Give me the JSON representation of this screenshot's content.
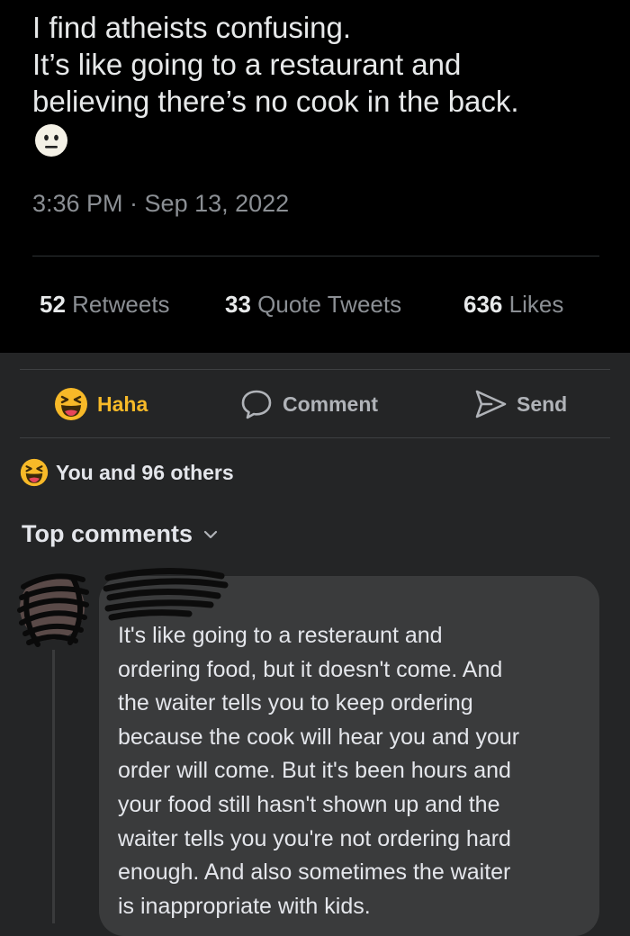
{
  "tweet": {
    "lines": [
      "I find atheists confusing.",
      "It’s like going to a restaurant and",
      "believing there’s no cook in the back."
    ],
    "emoji": "neutral-face-icon",
    "timestamp": "3:36 PM · Sep 13, 2022",
    "stats": {
      "retweets_count": "52",
      "retweets_label": "Retweets",
      "quotes_count": "33",
      "quotes_label": "Quote Tweets",
      "likes_count": "636",
      "likes_label": "Likes"
    }
  },
  "actions": {
    "haha_label": "Haha",
    "comment_label": "Comment",
    "send_label": "Send"
  },
  "reactions_summary": "You and 96 others",
  "comments_header": "Top comments",
  "comment": {
    "lines": [
      "It's like going to a resteraunt and",
      "ordering food, but it doesn't come. And",
      "the waiter tells you to keep ordering",
      "because the cook will hear you and your",
      "order will come. But it's been hours and",
      "your food still hasn't shown up and the",
      "waiter tells you you're not ordering hard",
      "enough. And also sometimes the waiter",
      "is inappropriate with kids."
    ]
  },
  "colors": {
    "tweet_bg": "#000000",
    "fb_bg": "#242526",
    "bubble_bg": "#3a3b3c",
    "haha_yellow": "#f7b928"
  }
}
